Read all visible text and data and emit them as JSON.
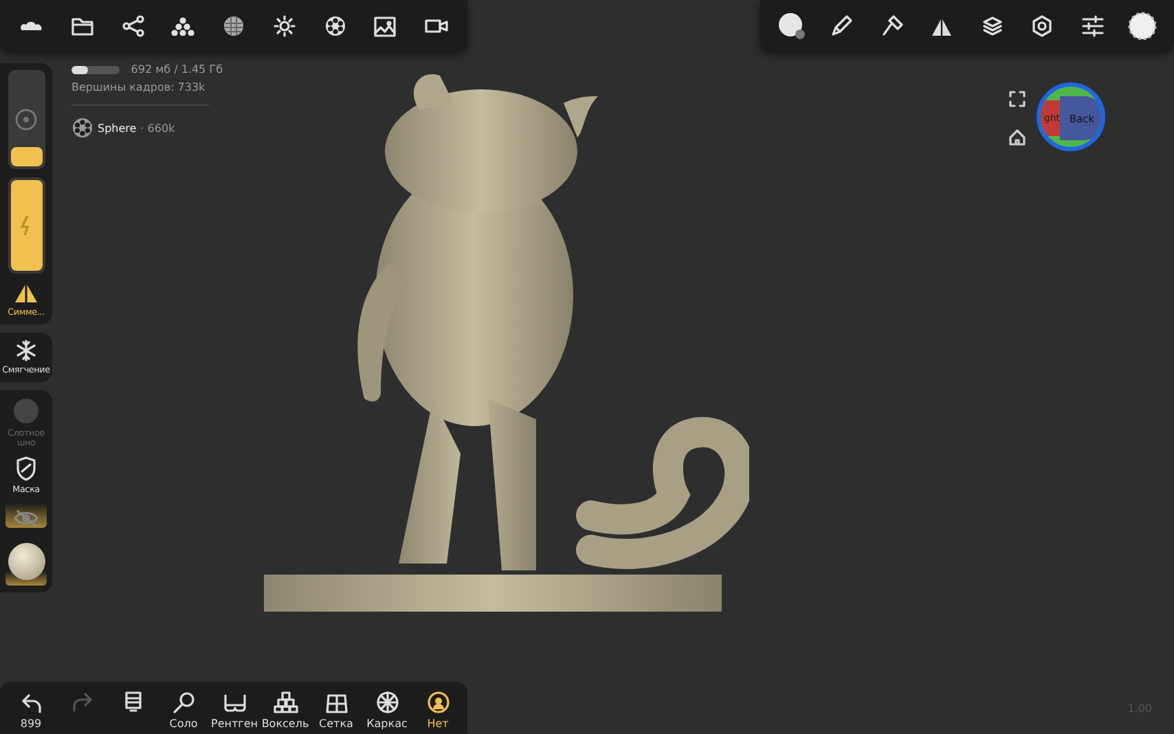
{
  "memory": {
    "level": 0.35,
    "text": "692 мб / 1.45 Гб"
  },
  "vertices": "Вершины кадров:  733k",
  "scene": [
    {
      "name": "Sphere",
      "count": "· 660k"
    }
  ],
  "sliders": [
    {
      "kind": "radius",
      "level": 0.2
    },
    {
      "kind": "intensity",
      "level": 1
    }
  ],
  "left_tools": [
    {
      "kind": "symmetry",
      "label": "Симме...",
      "active": true,
      "disabled": false
    },
    {
      "kind": "smooth",
      "label": "Смягчение",
      "active": false,
      "disabled": false
    },
    {
      "kind": "layer",
      "label": "Слотное шно",
      "active": false,
      "disabled": true
    },
    {
      "kind": "mask",
      "label": "Маска",
      "active": false,
      "disabled": false
    }
  ],
  "gizmo": {
    "left_face": "ght",
    "front_face": "Back"
  },
  "bottom_tools": [
    {
      "kind": "undo",
      "label": "899",
      "disabled": false,
      "selected": false
    },
    {
      "kind": "redo",
      "disabled": true,
      "selected": false
    },
    {
      "kind": "book",
      "disabled": false,
      "selected": false
    },
    {
      "kind": "solo",
      "label": "Соло",
      "disabled": false,
      "selected": false
    },
    {
      "kind": "xray",
      "label": "Рентген",
      "disabled": false,
      "selected": false
    },
    {
      "kind": "voxel",
      "label": "Воксель",
      "disabled": false,
      "selected": false
    },
    {
      "kind": "grid",
      "label": "Сетка",
      "disabled": false,
      "selected": false
    },
    {
      "kind": "wire",
      "label": "Каркас",
      "disabled": false,
      "selected": false
    },
    {
      "kind": "none",
      "label": "Нет",
      "disabled": false,
      "selected": true
    }
  ],
  "zoom_value": "1.00"
}
